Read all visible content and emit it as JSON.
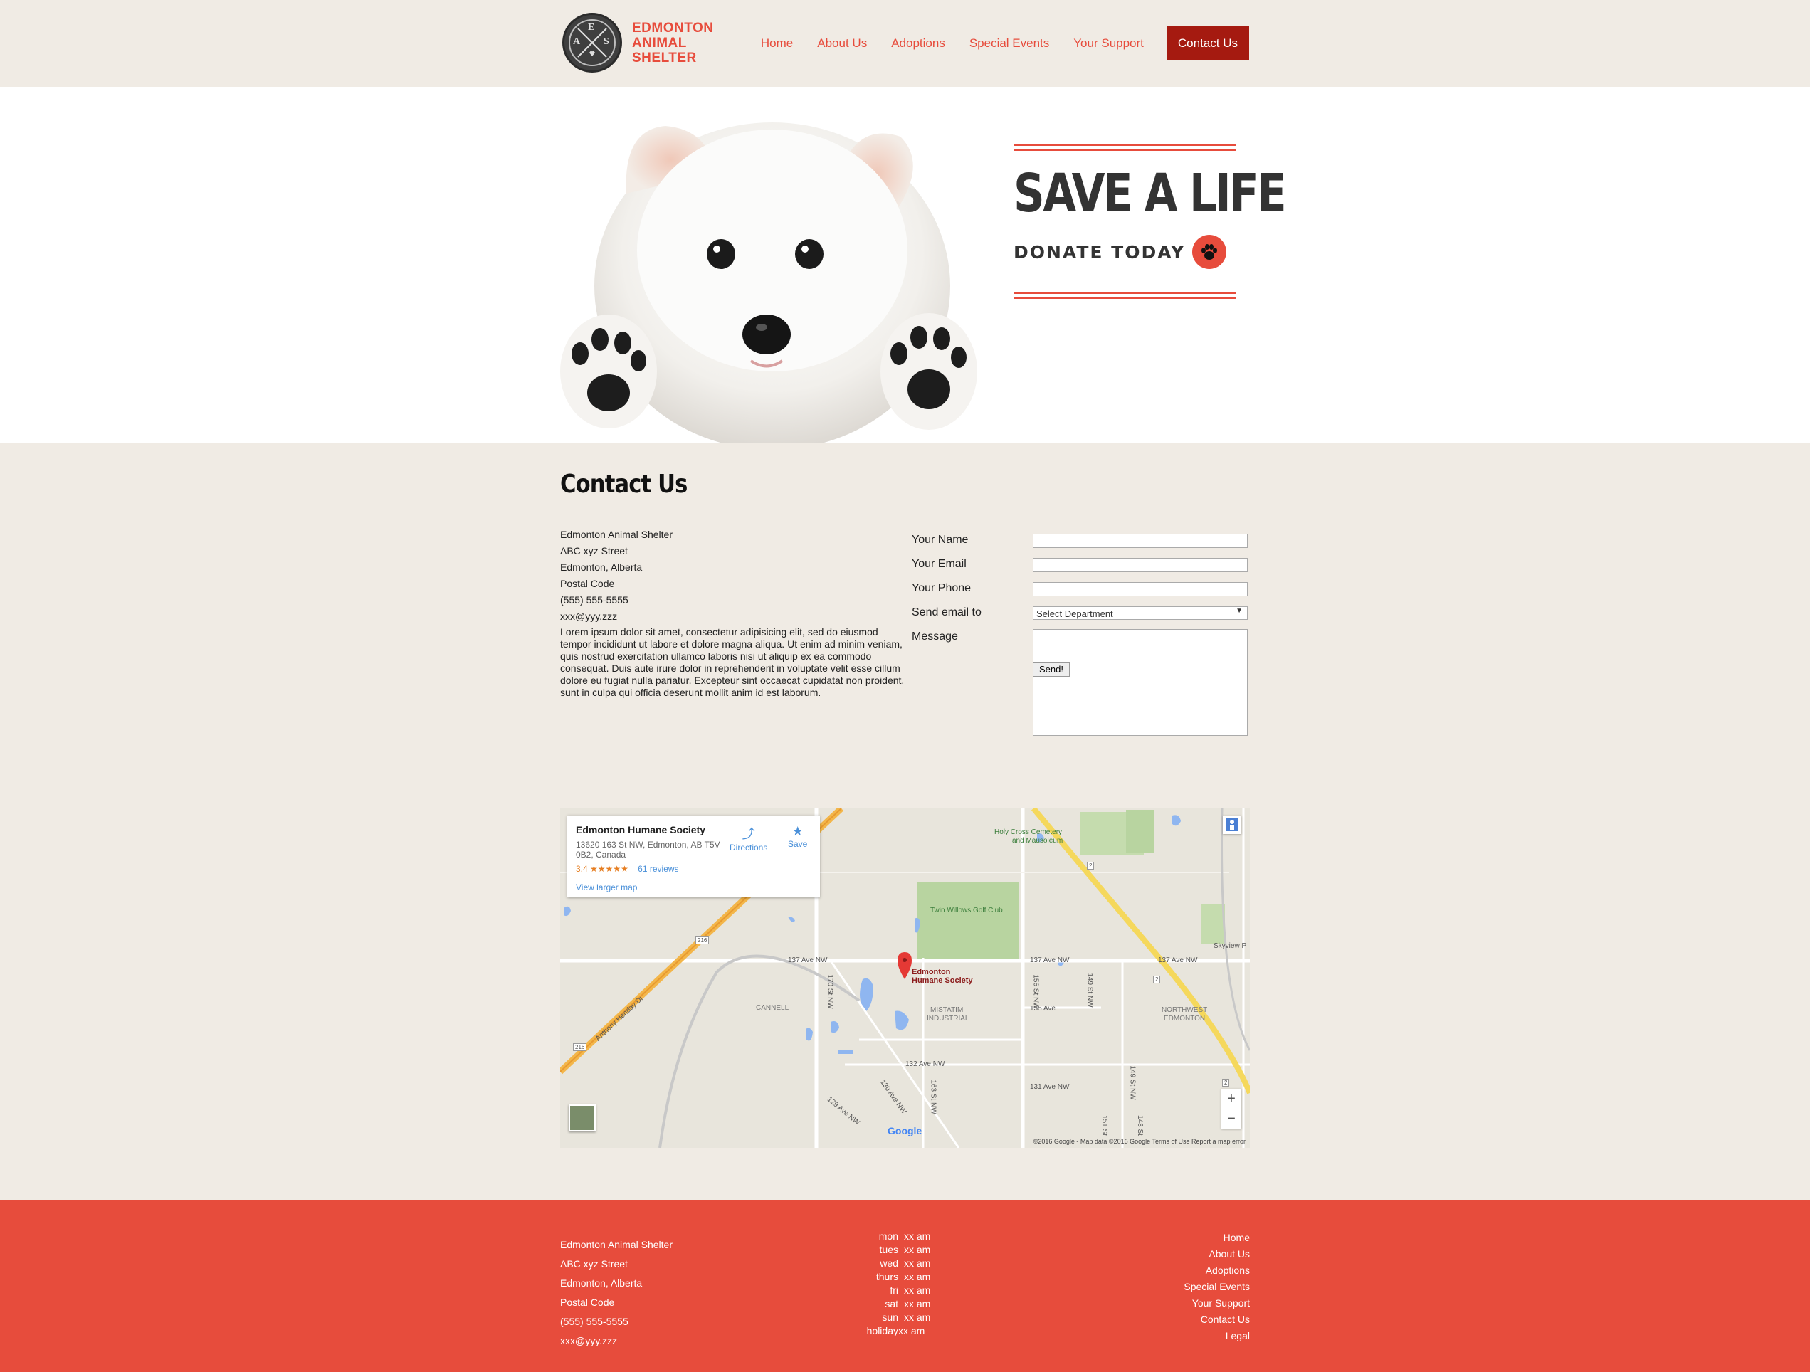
{
  "brand": {
    "line1": "EDMONTON",
    "line2": "ANIMAL",
    "line3": "SHELTER",
    "badge_letters": [
      "A",
      "E",
      "S"
    ]
  },
  "nav": {
    "items": [
      {
        "label": "Home"
      },
      {
        "label": "About Us"
      },
      {
        "label": "Adoptions"
      },
      {
        "label": "Special Events"
      },
      {
        "label": "Your Support"
      },
      {
        "label": "Contact Us",
        "active": true
      }
    ]
  },
  "hero": {
    "headline": "SAVE A LIFE",
    "cta": "DONATE TODAY"
  },
  "contact": {
    "title": "Contact Us",
    "address": {
      "name": "Edmonton Animal Shelter",
      "street": "ABC xyz Street",
      "city": "Edmonton, Alberta",
      "postal": "Postal Code",
      "phone": "(555) 555-5555",
      "email": "xxx@yyy.zzz"
    },
    "blurb": "Lorem ipsum dolor sit amet, consectetur adipisicing elit, sed do eiusmod tempor incididunt ut labore et dolore magna aliqua. Ut enim ad minim veniam, quis nostrud exercitation ullamco laboris nisi ut aliquip ex ea commodo consequat. Duis aute irure dolor in reprehenderit in voluptate velit esse cillum dolore eu fugiat nulla pariatur. Excepteur sint occaecat cupidatat non proident, sunt in culpa qui officia deserunt mollit anim id est laborum.",
    "form": {
      "name_label": "Your Name",
      "email_label": "Your Email",
      "phone_label": "Your Phone",
      "dept_label": "Send email to",
      "dept_value": "Select Department",
      "message_label": "Message",
      "send_label": "Send!"
    }
  },
  "map": {
    "place_name": "Edmonton Humane Society",
    "place_address": "13620 163 St NW, Edmonton, AB T5V 0B2, Canada",
    "rating": "3.4",
    "stars": "★★★★★",
    "reviews": "61 reviews",
    "directions": "Directions",
    "save": "Save",
    "larger_map": "View larger map",
    "marker_label_1": "Edmonton",
    "marker_label_2": "Humane Society",
    "labels": {
      "cemetery_1": "Holy Cross Cemetery",
      "cemetery_2": "and Mausoleum",
      "golf": "Twin Willows Golf Club",
      "ave137_a": "137 Ave NW",
      "ave137_b": "137 Ave NW",
      "ave137_c": "137 Ave NW",
      "ave135": "135 Ave",
      "ave132": "132 Ave NW",
      "ave131": "131 Ave NW",
      "st170": "170 St NW",
      "st156": "156 St NW",
      "st149": "149 St NW",
      "st149b": "149 St NW",
      "st163": "163 St NW",
      "st151": "151 St",
      "st148": "148 St",
      "ave130": "130 Ave NW",
      "ave129": "129 Ave NW",
      "anthony": "Anthony Henday Dr",
      "cannell": "CANNELL",
      "mistatim_1": "MISTATIM",
      "mistatim_2": "INDUSTRIAL",
      "nw_1": "NORTHWEST",
      "nw_2": "EDMONTON",
      "skyview": "Skyview P",
      "hwy216a": "216",
      "hwy216b": "216",
      "hwy2a": "2",
      "hwy2b": "2",
      "hwy2c": "2"
    },
    "zoom_in": "+",
    "zoom_out": "−",
    "google": "Google",
    "attribution": "©2016 Google - Map data ©2016 Google    Terms of Use    Report a map error"
  },
  "footer": {
    "address": [
      "Edmonton Animal Shelter",
      "ABC xyz Street",
      "Edmonton, Alberta",
      "Postal Code",
      "(555) 555-5555",
      "xxx@yyy.zzz"
    ],
    "hours": [
      {
        "day": "mon",
        "time": "xx am"
      },
      {
        "day": "tues",
        "time": "xx am"
      },
      {
        "day": "wed",
        "time": "xx am"
      },
      {
        "day": "thurs",
        "time": "xx am"
      },
      {
        "day": "fri",
        "time": "xx am"
      },
      {
        "day": "sat",
        "time": "xx am"
      },
      {
        "day": "sun",
        "time": "xx am"
      },
      {
        "day": "holiday",
        "time": "xx am"
      }
    ],
    "links": [
      "Home",
      "About Us",
      "Adoptions",
      "Special Events",
      "Your Support",
      "Contact Us",
      "Legal"
    ]
  },
  "colors": {
    "accent": "#e74c3c",
    "active_nav": "#a51a10",
    "background": "#f0ebe4",
    "dark_text": "#333333"
  }
}
